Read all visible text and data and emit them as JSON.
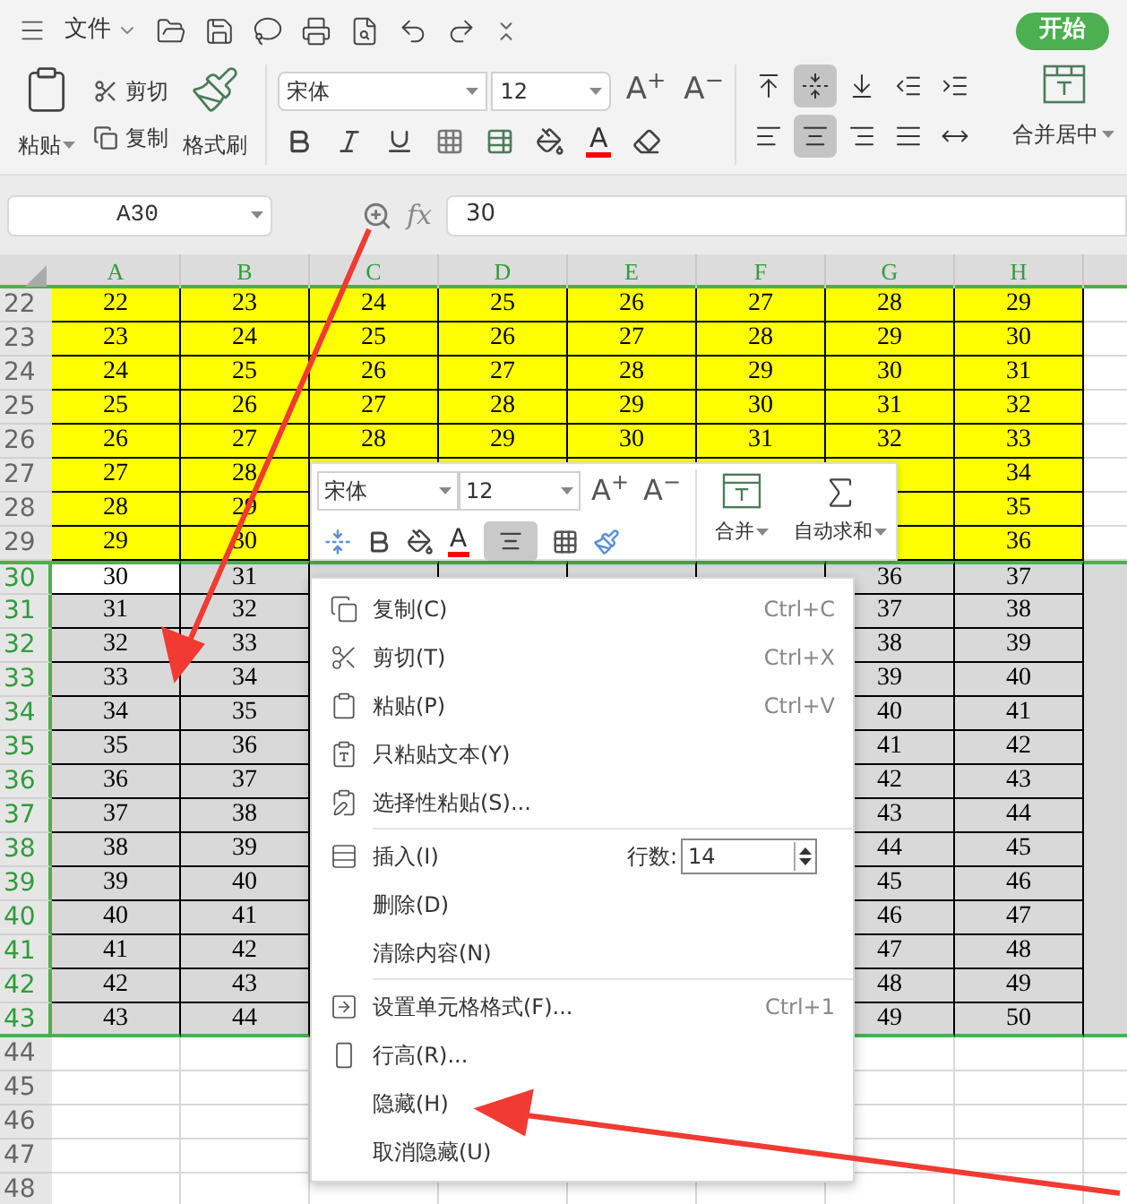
{
  "quick_bar": {
    "file_menu": "文件",
    "start_button": "开始"
  },
  "ribbon": {
    "paste": "粘贴",
    "cut": "剪切",
    "copy": "复制",
    "format_painter": "格式刷",
    "font_name": "宋体",
    "font_size": "12",
    "grow_font": "A$^{+}$",
    "shrink_font": "A$^{−}$",
    "font_color": "A",
    "merge": "合并居中",
    "alignment": [
      {
        "kind": "top",
        "selected": false
      },
      {
        "kind": "middle",
        "selected": true
      },
      {
        "kind": "bottom",
        "selected": false
      },
      {
        "kind": "outdent",
        "selected": false
      },
      {
        "kind": "indent",
        "selected": false
      },
      {
        "kind": "left",
        "selected": false
      },
      {
        "kind": "center",
        "selected": true
      },
      {
        "kind": "right",
        "selected": false
      },
      {
        "kind": "justify",
        "selected": false
      },
      {
        "kind": "distribute",
        "selected": false
      }
    ]
  },
  "formula_bar": {
    "name_box": "A30",
    "function_label": "fx",
    "value": "30"
  },
  "columns": [
    {
      "label": "A",
      "selected": true
    },
    {
      "label": "B",
      "selected": true
    },
    {
      "label": "C",
      "selected": true
    },
    {
      "label": "D",
      "selected": true
    },
    {
      "label": "E",
      "selected": true
    },
    {
      "label": "F",
      "selected": true
    },
    {
      "label": "G",
      "selected": true
    },
    {
      "label": "H",
      "selected": true
    }
  ],
  "rows": [
    {
      "number": "22",
      "color": "#ffff00",
      "selected": false,
      "cells": [
        "22",
        "23",
        "24",
        "25",
        "26",
        "27",
        "28",
        "29"
      ]
    },
    {
      "number": "23",
      "color": "#ffff00",
      "selected": false,
      "cells": [
        "23",
        "24",
        "25",
        "26",
        "27",
        "28",
        "29",
        "30"
      ]
    },
    {
      "number": "24",
      "color": "#ffff00",
      "selected": false,
      "cells": [
        "24",
        "25",
        "26",
        "27",
        "28",
        "29",
        "30",
        "31"
      ]
    },
    {
      "number": "25",
      "color": "#ffff00",
      "selected": false,
      "cells": [
        "25",
        "26",
        "27",
        "28",
        "29",
        "30",
        "31",
        "32"
      ]
    },
    {
      "number": "26",
      "color": "#ffff00",
      "selected": false,
      "cells": [
        "26",
        "27",
        "28",
        "29",
        "30",
        "31",
        "32",
        "33"
      ]
    },
    {
      "number": "27",
      "color": "#ffff00",
      "selected": false,
      "cells": [
        "27",
        "28",
        null,
        null,
        null,
        null,
        null,
        "34"
      ]
    },
    {
      "number": "28",
      "color": "#ffff00",
      "selected": false,
      "cells": [
        "28",
        "29",
        null,
        null,
        null,
        null,
        null,
        "35"
      ]
    },
    {
      "number": "29",
      "color": "#ffff00",
      "selected": false,
      "cells": [
        "29",
        "30",
        null,
        null,
        null,
        null,
        null,
        "36"
      ]
    },
    {
      "number": "30",
      "color": "#d9d9d9",
      "selected": true,
      "active": true,
      "cells": [
        "30",
        "31",
        null,
        null,
        null,
        null,
        "36",
        "37"
      ]
    },
    {
      "number": "31",
      "color": "#d9d9d9",
      "selected": true,
      "cells": [
        "31",
        "32",
        null,
        null,
        null,
        null,
        "37",
        "38"
      ]
    },
    {
      "number": "32",
      "color": "#d9d9d9",
      "selected": true,
      "cells": [
        "32",
        "33",
        null,
        null,
        null,
        null,
        "38",
        "39"
      ]
    },
    {
      "number": "33",
      "color": "#d9d9d9",
      "selected": true,
      "cells": [
        "33",
        "34",
        null,
        null,
        null,
        null,
        "39",
        "40"
      ]
    },
    {
      "number": "34",
      "color": "#d9d9d9",
      "selected": true,
      "cells": [
        "34",
        "35",
        null,
        null,
        null,
        null,
        "40",
        "41"
      ]
    },
    {
      "number": "35",
      "color": "#d9d9d9",
      "selected": true,
      "cells": [
        "35",
        "36",
        null,
        null,
        null,
        null,
        "41",
        "42"
      ]
    },
    {
      "number": "36",
      "color": "#d9d9d9",
      "selected": true,
      "cells": [
        "36",
        "37",
        null,
        null,
        null,
        null,
        "42",
        "43"
      ]
    },
    {
      "number": "37",
      "color": "#d9d9d9",
      "selected": true,
      "cells": [
        "37",
        "38",
        null,
        null,
        null,
        null,
        "43",
        "44"
      ]
    },
    {
      "number": "38",
      "color": "#d9d9d9",
      "selected": true,
      "cells": [
        "38",
        "39",
        null,
        null,
        null,
        null,
        "44",
        "45"
      ]
    },
    {
      "number": "39",
      "color": "#d9d9d9",
      "selected": true,
      "cells": [
        "39",
        "40",
        null,
        null,
        null,
        null,
        "45",
        "46"
      ]
    },
    {
      "number": "40",
      "color": "#d9d9d9",
      "selected": true,
      "cells": [
        "40",
        "41",
        null,
        null,
        null,
        null,
        "46",
        "47"
      ]
    },
    {
      "number": "41",
      "color": "#d9d9d9",
      "selected": true,
      "cells": [
        "41",
        "42",
        null,
        null,
        null,
        null,
        "47",
        "48"
      ]
    },
    {
      "number": "42",
      "color": "#d9d9d9",
      "selected": true,
      "cells": [
        "42",
        "43",
        null,
        null,
        null,
        null,
        "48",
        "49"
      ]
    },
    {
      "number": "43",
      "color": "#d9d9d9",
      "selected": true,
      "cells": [
        "43",
        "44",
        null,
        null,
        null,
        null,
        "49",
        "50"
      ]
    },
    {
      "number": "44",
      "color": "#ffffff",
      "selected": false
    },
    {
      "number": "45",
      "color": "#ffffff",
      "selected": false
    },
    {
      "number": "46",
      "color": "#ffffff",
      "selected": false
    },
    {
      "number": "47",
      "color": "#ffffff",
      "selected": false
    },
    {
      "number": "48",
      "color": "#ffffff",
      "selected": false
    }
  ],
  "mini_toolbar": {
    "font_name": "宋体",
    "font_size": "12",
    "grow_font": "A$^{+}$",
    "shrink_font": "A$^{−}$",
    "font_color": "A",
    "align_pressed": true,
    "merge": "合并",
    "autosum": "自动求和"
  },
  "context_menu": [
    {
      "kind": "item",
      "label": "复制(C)",
      "shortcut": "Ctrl+C"
    },
    {
      "kind": "item",
      "label": "剪切(T)",
      "shortcut": "Ctrl+X"
    },
    {
      "kind": "item",
      "label": "粘贴(P)",
      "shortcut": "Ctrl+V"
    },
    {
      "kind": "item",
      "label": "只粘贴文本(Y)"
    },
    {
      "kind": "item",
      "label": "选择性粘贴(S)..."
    },
    {
      "kind": "separator"
    },
    {
      "kind": "count",
      "label": "插入(I)",
      "count_label": "行数:",
      "count_value": "14"
    },
    {
      "kind": "item",
      "label": "删除(D)"
    },
    {
      "kind": "item",
      "label": "清除内容(N)"
    },
    {
      "kind": "separator"
    },
    {
      "kind": "item",
      "label": "设置单元格格式(F)...",
      "shortcut": "Ctrl+1"
    },
    {
      "kind": "item",
      "label": "行高(R)..."
    },
    {
      "kind": "item",
      "label": "隐藏(H)"
    },
    {
      "kind": "item",
      "label": "取消隐藏(U)"
    }
  ]
}
